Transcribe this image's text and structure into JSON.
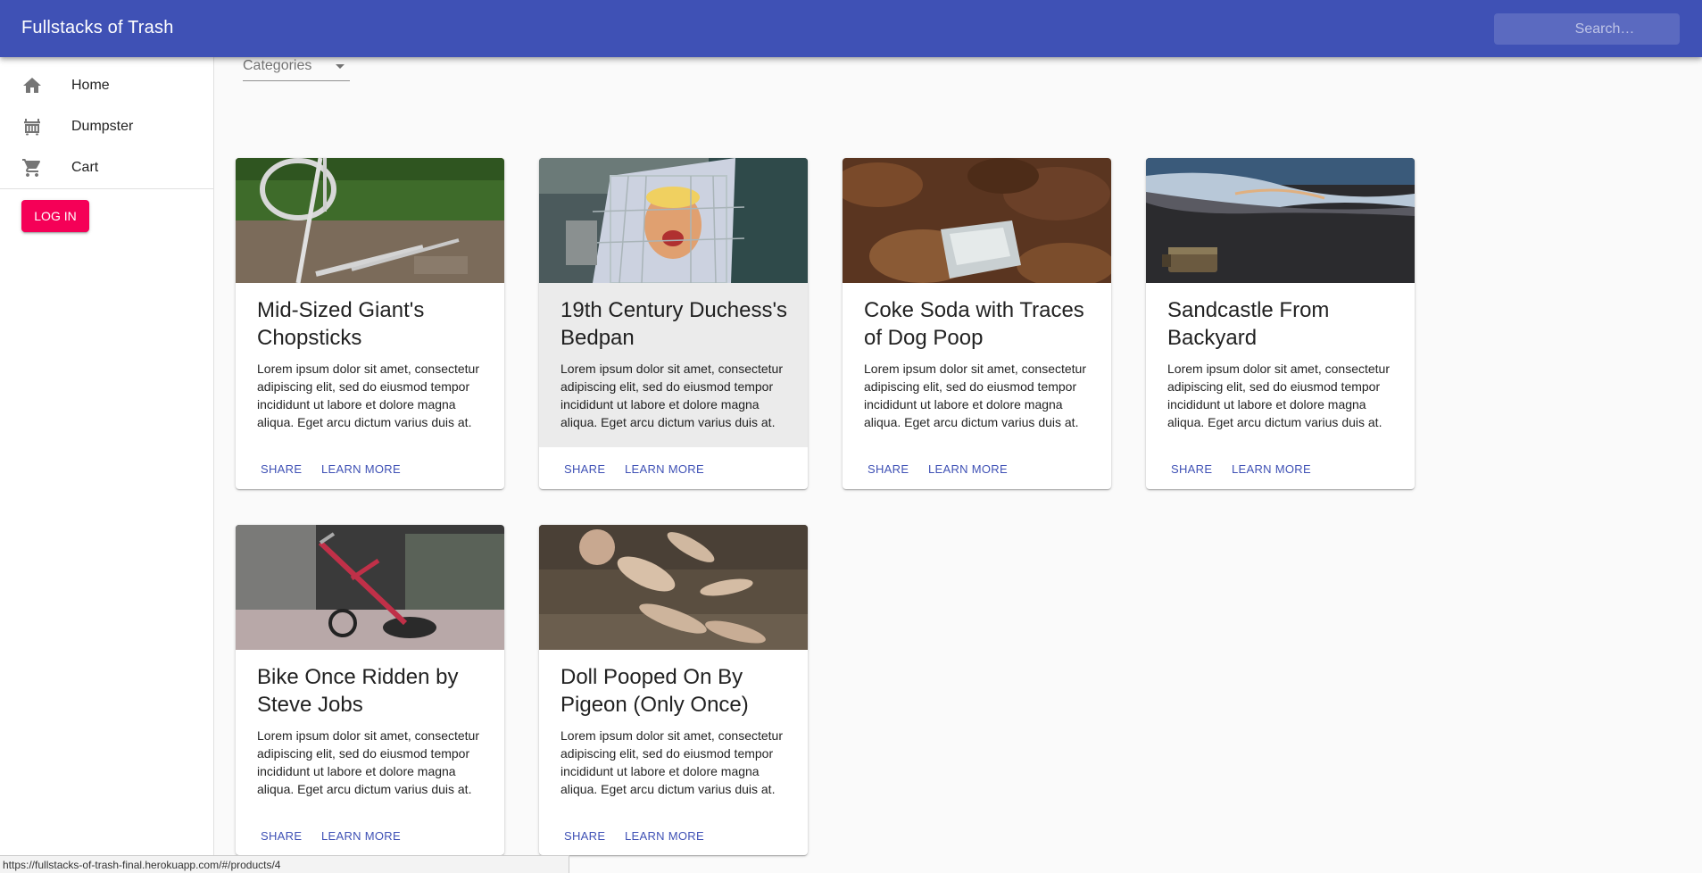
{
  "app": {
    "title": "Fullstacks of Trash"
  },
  "search": {
    "placeholder": "Search…"
  },
  "sidebar": {
    "items": [
      {
        "label": "Home",
        "icon": "home-icon"
      },
      {
        "label": "Dumpster",
        "icon": "dumpster-icon"
      },
      {
        "label": "Cart",
        "icon": "cart-icon"
      }
    ],
    "login_label": "LOG IN"
  },
  "filter": {
    "categories_label": "Categories"
  },
  "products": [
    {
      "title": "Mid-Sized Giant's Chopsticks",
      "description": "Lorem ipsum dolor sit amet, consectetur adipiscing elit, sed do eiusmod tempor incididunt ut labore et dolore magna aliqua. Eget arcu dictum varius duis at.",
      "share_label": "SHARE",
      "learn_label": "LEARN MORE"
    },
    {
      "title": "19th Century Duchess's Bedpan",
      "description": "Lorem ipsum dolor sit amet, consectetur adipiscing elit, sed do eiusmod tempor incididunt ut labore et dolore magna aliqua. Eget arcu dictum varius duis at.",
      "share_label": "SHARE",
      "learn_label": "LEARN MORE"
    },
    {
      "title": "Coke Soda with Traces of Dog Poop",
      "description": "Lorem ipsum dolor sit amet, consectetur adipiscing elit, sed do eiusmod tempor incididunt ut labore et dolore magna aliqua. Eget arcu dictum varius duis at.",
      "share_label": "SHARE",
      "learn_label": "LEARN MORE"
    },
    {
      "title": "Sandcastle From Backyard",
      "description": "Lorem ipsum dolor sit amet, consectetur adipiscing elit, sed do eiusmod tempor incididunt ut labore et dolore magna aliqua. Eget arcu dictum varius duis at.",
      "share_label": "SHARE",
      "learn_label": "LEARN MORE"
    },
    {
      "title": "Bike Once Ridden by Steve Jobs",
      "description": "Lorem ipsum dolor sit amet, consectetur adipiscing elit, sed do eiusmod tempor incididunt ut labore et dolore magna aliqua. Eget arcu dictum varius duis at.",
      "share_label": "SHARE",
      "learn_label": "LEARN MORE"
    },
    {
      "title": "Doll Pooped On By Pigeon (Only Once)",
      "description": "Lorem ipsum dolor sit amet, consectetur adipiscing elit, sed do eiusmod tempor incididunt ut labore et dolore magna aliqua. Eget arcu dictum varius duis at.",
      "share_label": "SHARE",
      "learn_label": "LEARN MORE"
    }
  ],
  "status_bar": {
    "url": "https://fullstacks-of-trash-final.herokuapp.com/#/products/4"
  },
  "colors": {
    "primary": "#3f51b5",
    "secondary": "#f50057",
    "background": "#fafafa"
  }
}
